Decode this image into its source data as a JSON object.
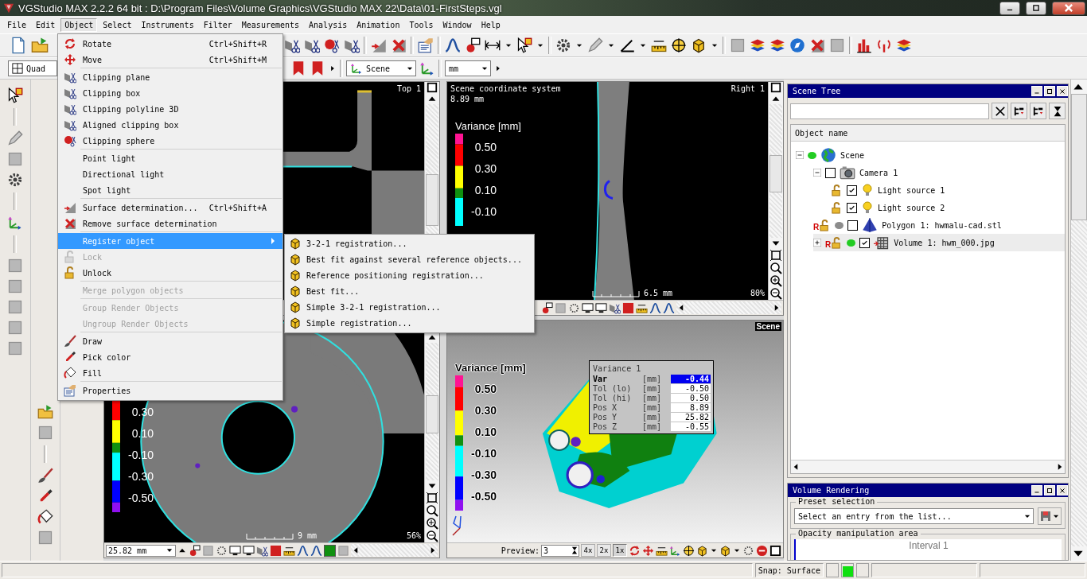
{
  "window": {
    "title": "VGStudio MAX 2.2.2 64 bit :  D:\\Program Files\\Volume Graphics\\VGStudio MAX 22\\Data\\01-FirstSteps.vgl"
  },
  "menu_bar": [
    {
      "label": "File",
      "selected": false
    },
    {
      "label": "Edit",
      "selected": false
    },
    {
      "label": "Object",
      "selected": true
    },
    {
      "label": "Select",
      "selected": false
    },
    {
      "label": "Instruments",
      "selected": false
    },
    {
      "label": "Filter",
      "selected": false
    },
    {
      "label": "Measurements",
      "selected": false
    },
    {
      "label": "Analysis",
      "selected": false
    },
    {
      "label": "Animation",
      "selected": false
    },
    {
      "label": "Tools",
      "selected": false
    },
    {
      "label": "Window",
      "selected": false
    },
    {
      "label": "Help",
      "selected": false
    }
  ],
  "toolbar": {
    "view_layout": "Quad",
    "coordinate_system": "Scene",
    "unit": "mm"
  },
  "object_menu": [
    {
      "kind": "item",
      "label": "Rotate",
      "shortcut": "Ctrl+Shift+R",
      "disabled": false,
      "selected": false
    },
    {
      "kind": "item",
      "label": "Move",
      "shortcut": "Ctrl+Shift+M",
      "disabled": false,
      "selected": false
    },
    {
      "kind": "separator"
    },
    {
      "kind": "item",
      "label": "Clipping plane",
      "disabled": false,
      "selected": false
    },
    {
      "kind": "item",
      "label": "Clipping box",
      "disabled": false,
      "selected": false
    },
    {
      "kind": "item",
      "label": "Clipping polyline 3D",
      "disabled": false,
      "selected": false
    },
    {
      "kind": "item",
      "label": "Aligned clipping box",
      "disabled": false,
      "selected": false
    },
    {
      "kind": "item",
      "label": "Clipping sphere",
      "disabled": false,
      "selected": false
    },
    {
      "kind": "separator"
    },
    {
      "kind": "item",
      "label": "Point light",
      "disabled": false,
      "selected": false
    },
    {
      "kind": "item",
      "label": "Directional light",
      "disabled": false,
      "selected": false
    },
    {
      "kind": "item",
      "label": "Spot light",
      "disabled": false,
      "selected": false
    },
    {
      "kind": "separator"
    },
    {
      "kind": "item",
      "label": "Surface determination...",
      "shortcut": "Ctrl+Shift+A",
      "disabled": false,
      "selected": false
    },
    {
      "kind": "item",
      "label": "Remove surface determination",
      "disabled": false,
      "selected": false
    },
    {
      "kind": "separator"
    },
    {
      "kind": "item",
      "label": "Register object",
      "disabled": false,
      "selected": true,
      "submenu": [
        "3-2-1 registration...",
        "Best fit against several reference objects...",
        "Reference positioning registration...",
        "Best fit...",
        "Simple 3-2-1 registration...",
        "Simple registration..."
      ]
    },
    {
      "kind": "item",
      "label": "Lock",
      "disabled": true,
      "selected": false
    },
    {
      "kind": "item",
      "label": "Unlock",
      "disabled": false,
      "selected": false
    },
    {
      "kind": "separator"
    },
    {
      "kind": "item",
      "label": "Merge polygon objects",
      "disabled": true,
      "selected": false
    },
    {
      "kind": "separator"
    },
    {
      "kind": "item",
      "label": "Group Render Objects",
      "disabled": true,
      "selected": false
    },
    {
      "kind": "item",
      "label": "Ungroup Render Objects",
      "disabled": true,
      "selected": false
    },
    {
      "kind": "separator"
    },
    {
      "kind": "item",
      "label": "Draw",
      "disabled": false,
      "selected": false
    },
    {
      "kind": "item",
      "label": "Pick color",
      "disabled": false,
      "selected": false
    },
    {
      "kind": "item",
      "label": "Fill",
      "disabled": false,
      "selected": false
    },
    {
      "kind": "separator"
    },
    {
      "kind": "item",
      "label": "Properties",
      "disabled": false,
      "selected": false
    }
  ],
  "viewports": [
    {
      "kind": "slice",
      "label": "Top 1"
    },
    {
      "kind": "slice",
      "label": "Right 1",
      "coordinate_system": "Scene coordinate system",
      "position": "8.89 mm",
      "legend": {
        "title": "Variance [mm]",
        "labels": [
          "0.50",
          "0.30",
          "0.10",
          "-0.10"
        ]
      },
      "scale": "6.5 mm",
      "zoom": "80%"
    },
    {
      "kind": "slice",
      "legend": {
        "labels": [
          "0.30",
          "0.10",
          "-0.10",
          "-0.30",
          "-0.50"
        ]
      },
      "scale": "9 mm",
      "zoom": "56%",
      "position_field": "25.82 mm"
    },
    {
      "kind": "scene",
      "label": "Scene",
      "legend": {
        "title": "Variance [mm]",
        "labels": [
          "0.50",
          "0.30",
          "0.10",
          "-0.10",
          "-0.30",
          "-0.50"
        ]
      },
      "readout": {
        "title": "Variance 1",
        "rows": [
          {
            "label": "Var",
            "unit": "[mm]",
            "value": "-0.44",
            "selected": true
          },
          {
            "label": "Tol (lo)",
            "unit": "[mm]",
            "value": "-0.50",
            "selected": false
          },
          {
            "label": "Tol (hi)",
            "unit": "[mm]",
            "value": "0.50",
            "selected": false
          },
          {
            "label": "Pos X",
            "unit": "[mm]",
            "value": "8.89",
            "selected": false
          },
          {
            "label": "Pos Y",
            "unit": "[mm]",
            "value": "25.82",
            "selected": false
          },
          {
            "label": "Pos Z",
            "unit": "[mm]",
            "value": "-0.55",
            "selected": false
          }
        ]
      },
      "preview_label": "Preview:",
      "preview_value": "3",
      "preview_buttons": [
        {
          "label": "4x",
          "selected": false
        },
        {
          "label": "2x",
          "selected": false
        },
        {
          "label": "1x",
          "selected": true
        }
      ]
    }
  ],
  "scene_tree": {
    "title": "Scene Tree",
    "column": "Object name",
    "nodes": [
      {
        "kind": "scene",
        "label": "Scene",
        "color": "#22cc22",
        "expanded": true,
        "selected": false,
        "children": [
          {
            "kind": "camera",
            "label": "Camera 1",
            "checked": false,
            "expanded": true,
            "selected": false,
            "children": [
              {
                "kind": "light",
                "label": "Light source 1",
                "checked": true,
                "selected": false
              },
              {
                "kind": "light",
                "label": "Light source 2",
                "checked": true,
                "selected": false
              }
            ]
          },
          {
            "kind": "polygon",
            "badge": "R",
            "label": "Polygon 1: hwmalu-cad.stl",
            "color": "#8c8c8c",
            "checked": false,
            "selected": false
          },
          {
            "kind": "volume",
            "badge": "R",
            "label": "Volume 1: hwm_000.jpg",
            "color": "#22cc22",
            "checked": true,
            "expanded": false,
            "selected": true
          }
        ]
      }
    ]
  },
  "volume_rendering": {
    "title": "Volume Rendering",
    "preset_label": "Preset selection",
    "preset_placeholder": "Select an entry from the list...",
    "opacity_label": "Opacity manipulation area",
    "interval": "Interval 1"
  },
  "status_bar": {
    "snap": "Snap: Surface"
  }
}
